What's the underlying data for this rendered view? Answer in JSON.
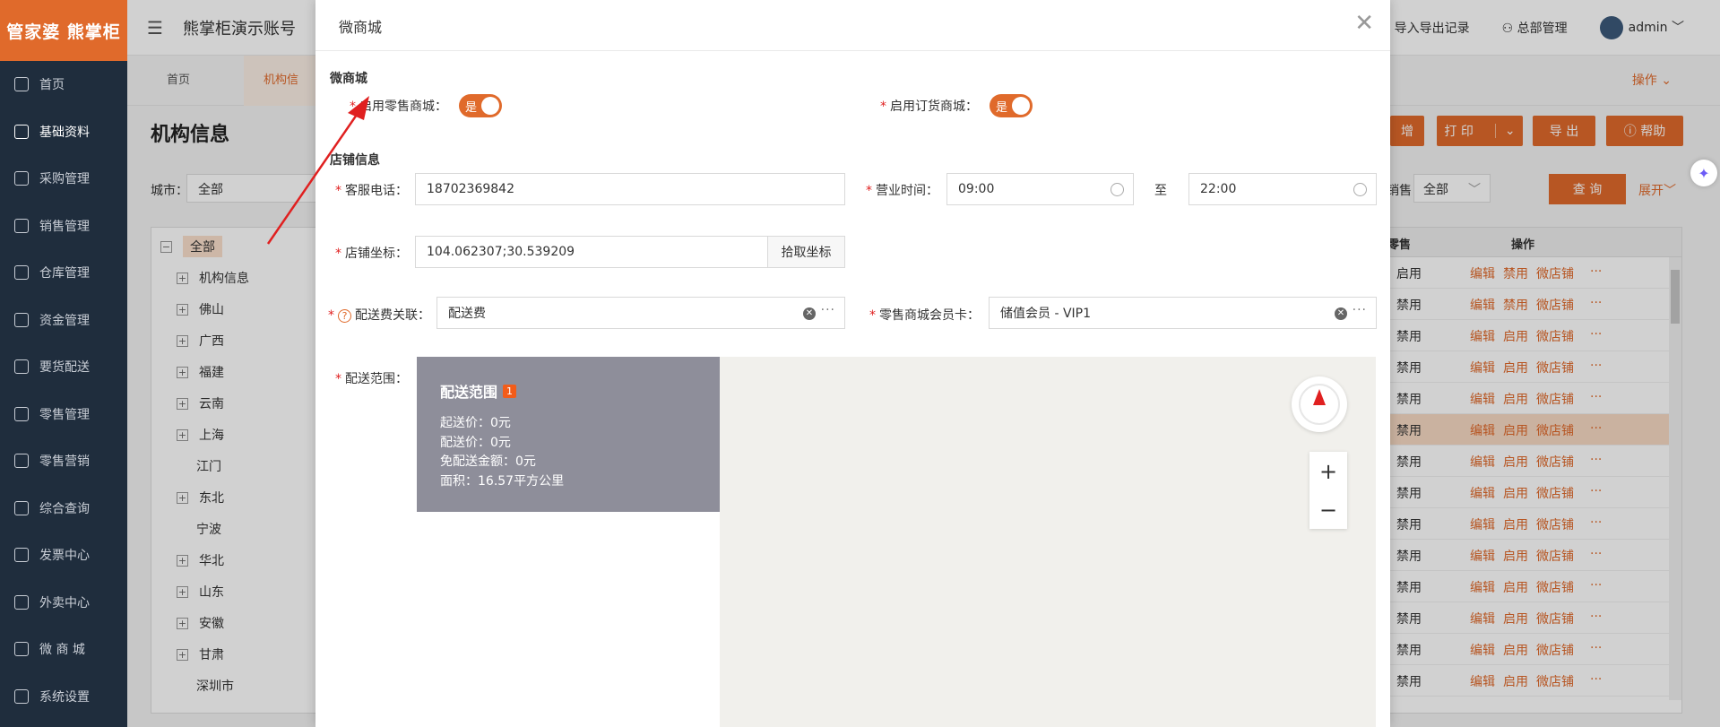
{
  "app": {
    "logo_text": "管家婆 熊掌柜",
    "org_title": "熊掌柜演示账号",
    "top_links": {
      "import_export": "导入导出记录",
      "hq_manage": "总部管理",
      "user": "admin"
    }
  },
  "sidebar": {
    "items": [
      {
        "label": "首页",
        "icon": "globe-icon"
      },
      {
        "label": "基础资料",
        "icon": "home-icon"
      },
      {
        "label": "采购管理",
        "icon": "cart-icon"
      },
      {
        "label": "销售管理",
        "icon": "sales-icon"
      },
      {
        "label": "仓库管理",
        "icon": "warehouse-icon"
      },
      {
        "label": "资金管理",
        "icon": "money-icon"
      },
      {
        "label": "要货配送",
        "icon": "delivery-icon"
      },
      {
        "label": "零售管理",
        "icon": "chart-icon"
      },
      {
        "label": "零售营销",
        "icon": "gift-icon"
      },
      {
        "label": "综合查询",
        "icon": "bar-chart-icon"
      },
      {
        "label": "发票中心",
        "icon": "invoice-icon"
      },
      {
        "label": "外卖中心",
        "icon": "takeaway-icon"
      },
      {
        "label": "微 商 城",
        "icon": "shop-bag-icon"
      },
      {
        "label": "系统设置",
        "icon": "settings-icon"
      }
    ]
  },
  "tabs": {
    "home": "首页",
    "org_info": "机构信",
    "ops": "操作"
  },
  "page": {
    "title": "机构信息",
    "city_label": "城市",
    "city_value": "全部",
    "buttons": {
      "add": "增",
      "print": "打 印",
      "export": "导 出",
      "help": "帮助"
    },
    "sales_label": "销售",
    "sales_value": "全部",
    "query": "查 询",
    "expand": "展开"
  },
  "tree": {
    "nodes": [
      "全部",
      "机构信息",
      "佛山",
      "广西",
      "福建",
      "云南",
      "上海",
      "江门",
      "东北",
      "宁波",
      "华北",
      "山东",
      "安徽",
      "甘肃",
      "深圳市"
    ]
  },
  "grid": {
    "headers": {
      "status": "零售",
      "ops": "操作"
    },
    "ops": {
      "edit": "编辑",
      "more": "···",
      "shop": "微店铺"
    },
    "rows": [
      {
        "status": "启用",
        "toggle": "禁用"
      },
      {
        "status": "禁用",
        "toggle": "禁用"
      },
      {
        "status": "禁用",
        "toggle": "启用"
      },
      {
        "status": "禁用",
        "toggle": "启用"
      },
      {
        "status": "禁用",
        "toggle": "启用"
      },
      {
        "status": "禁用",
        "toggle": "启用"
      },
      {
        "status": "禁用",
        "toggle": "启用"
      },
      {
        "status": "禁用",
        "toggle": "启用"
      },
      {
        "status": "禁用",
        "toggle": "启用"
      },
      {
        "status": "禁用",
        "toggle": "启用"
      },
      {
        "status": "禁用",
        "toggle": "启用"
      },
      {
        "status": "禁用",
        "toggle": "启用"
      },
      {
        "status": "禁用",
        "toggle": "启用"
      },
      {
        "status": "禁用",
        "toggle": "启用"
      }
    ]
  },
  "modal": {
    "title": "微商城",
    "section_mall": "微商城",
    "retail_mall_label": "启用零售商城",
    "retail_mall_value": "是",
    "order_mall_label": "启用订货商城",
    "order_mall_value": "是",
    "section_shop": "店铺信息",
    "service_phone_label": "客服电话",
    "service_phone_value": "18702369842",
    "hours_label": "营业时间",
    "hours_start": "09:00",
    "hours_to": "至",
    "hours_end": "22:00",
    "coord_label": "店铺坐标",
    "coord_value": "104.062307;30.539209",
    "pick_coord": "拾取坐标",
    "delivery_fee_label": "配送费关联",
    "delivery_fee_value": "配送费",
    "member_card_label": "零售商城会员卡",
    "member_card_value": "储值会员 - VIP1",
    "range_label": "配送范围",
    "zone": {
      "title": "配送范围",
      "badge": "1",
      "min_price": "起送价：0元",
      "delivery_price": "配送价：0元",
      "free_amount": "免配送金额：0元",
      "area": "面积：16.57平方公里"
    }
  },
  "colors": {
    "accent": "#e06a2b",
    "sidebar": "#1f2d3d",
    "zone_card": "#8e8e9a",
    "annotation_arrow": "#e02020"
  }
}
